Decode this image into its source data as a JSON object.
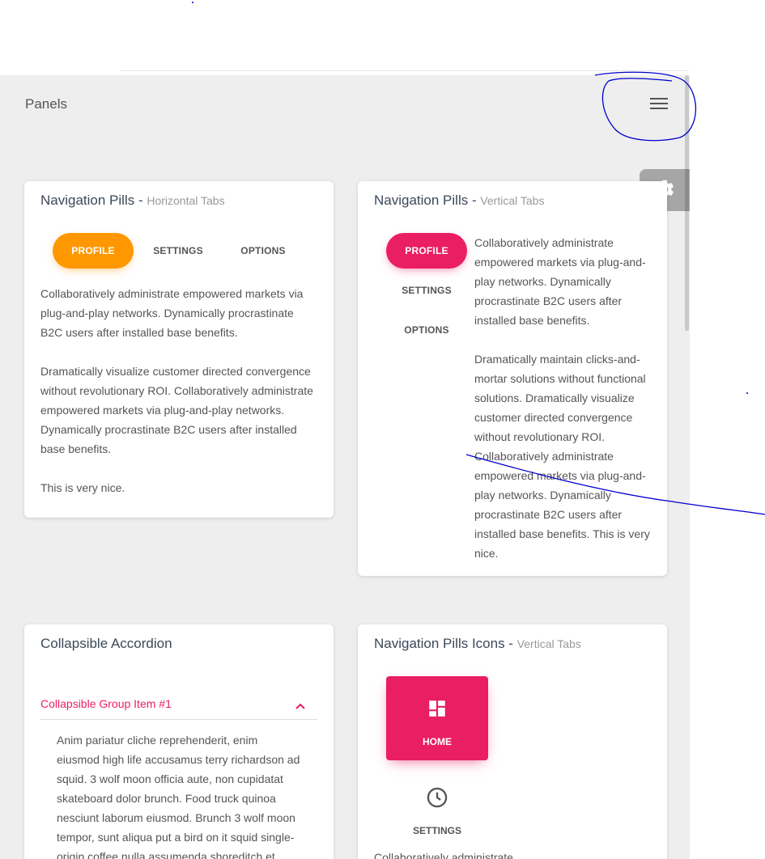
{
  "navbar": {
    "title": "Panels"
  },
  "cards": {
    "horizontal": {
      "title": "Navigation Pills - ",
      "subtitle": "Horizontal Tabs",
      "tabs": [
        "PROFILE",
        "SETTINGS",
        "OPTIONS"
      ],
      "paragraphs": [
        "Collaboratively administrate empowered markets via plug-and-play networks. Dynamically procrastinate B2C users after installed base benefits.",
        "Dramatically visualize customer directed convergence without revolutionary ROI. Collaboratively administrate empowered markets via plug-and-play networks. Dynamically procrastinate B2C users after installed base benefits.",
        "This is very nice."
      ]
    },
    "vertical": {
      "title": "Navigation Pills - ",
      "subtitle": "Vertical Tabs",
      "tabs": [
        "PROFILE",
        "SETTINGS",
        "OPTIONS"
      ],
      "paragraphs": [
        "Collaboratively administrate empowered markets via plug-and-play networks. Dynamically procrastinate B2C users after installed base benefits.",
        "Dramatically maintain clicks-and-mortar solutions without functional solutions. Dramatically visualize customer directed convergence without revolutionary ROI. Collaboratively administrate empowered markets via plug-and-play networks. Dynamically procrastinate B2C users after installed base benefits. This is very nice."
      ]
    },
    "accordion": {
      "title": "Collapsible Accordion",
      "item_title": "Collapsible Group Item #1",
      "item_body": "Anim pariatur cliche reprehenderit, enim eiusmod high life accusamus terry richardson ad squid. 3 wolf moon officia aute, non cupidatat skateboard dolor brunch. Food truck quinoa nesciunt laborum eiusmod. Brunch 3 wolf moon tempor, sunt aliqua put a bird on it squid single-origin coffee nulla assumenda shoreditch et. Nihil anim"
    },
    "icons": {
      "title": "Navigation Pills Icons - ",
      "subtitle": "Vertical Tabs",
      "tabs": [
        {
          "label": "HOME",
          "icon": "dashboard-icon"
        },
        {
          "label": "SETTINGS",
          "icon": "clock-icon"
        }
      ],
      "body": "Collaboratively administrate"
    }
  },
  "colors": {
    "orange": "#ff9800",
    "pink": "#e91e63",
    "background": "#eeeeee",
    "annotation": "#0000cc"
  }
}
